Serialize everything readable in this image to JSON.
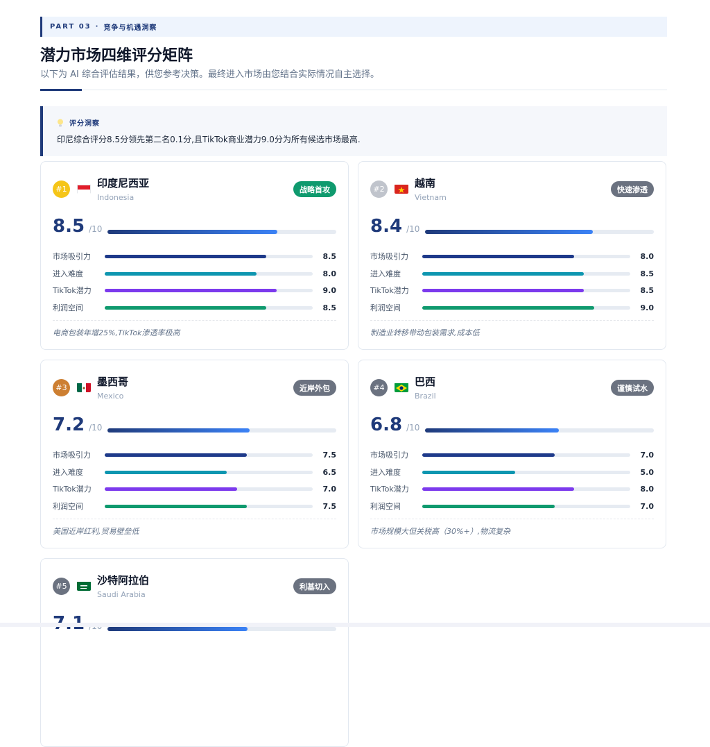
{
  "header": {
    "part_label": "PART 03",
    "part_sep": "·",
    "part_title": "竞争与机遇洞察",
    "title": "潜力市场四维评分矩阵",
    "subtitle": "以下为 AI 综合评估结果，供您参考决策。最终进入市场由您结合实际情况自主选择。"
  },
  "insight": {
    "icon": "lightbulb-icon",
    "label": "评分洞察",
    "text": "印尼综合评分8.5分领先第二名0.1分,且TikTok商业潜力9.0分为所有候选市场最高."
  },
  "score_suffix": "/10",
  "metric_labels": [
    "市场吸引力",
    "进入难度",
    "TikTok潜力",
    "利润空间"
  ],
  "metric_colors": [
    "#1e3a8a",
    "#0e96b0",
    "#7c3aed",
    "#0f9a6e"
  ],
  "markets": [
    {
      "rank": "#1",
      "rank_color": "#f5c518",
      "name": "印度尼西亚",
      "en": "Indonesia",
      "badge": "战略首攻",
      "badge_color": "#0f9a6e",
      "score": "8.5",
      "score_value": 8.5,
      "metrics": [
        "8.5",
        "8.0",
        "9.0",
        "8.5"
      ],
      "note": "电商包装年增25%,TikTok渗透率极高"
    },
    {
      "rank": "#2",
      "rank_color": "#c0c4cc",
      "name": "越南",
      "en": "Vietnam",
      "badge": "快速渗透",
      "badge_color": "#6b7280",
      "score": "8.4",
      "score_value": 8.4,
      "metrics": [
        "8.0",
        "8.5",
        "8.5",
        "9.0"
      ],
      "note": "制造业转移带动包装需求,成本低"
    },
    {
      "rank": "#3",
      "rank_color": "#cd7f32",
      "name": "墨西哥",
      "en": "Mexico",
      "badge": "近岸外包",
      "badge_color": "#6b7280",
      "score": "7.2",
      "score_value": 7.2,
      "metrics": [
        "7.5",
        "6.5",
        "7.0",
        "7.5"
      ],
      "note": "美国近岸红利,贸易壁垒低"
    },
    {
      "rank": "#4",
      "rank_color": "#6b7280",
      "name": "巴西",
      "en": "Brazil",
      "badge": "谨慎试水",
      "badge_color": "#6b7280",
      "score": "6.8",
      "score_value": 6.8,
      "metrics": [
        "7.0",
        "5.0",
        "8.0",
        "7.0"
      ],
      "note": "市场规模大但关税高（30%+）,物流复杂"
    },
    {
      "rank": "#5",
      "rank_color": "#6b7280",
      "name": "沙特阿拉伯",
      "en": "Saudi Arabia",
      "badge": "利基切入",
      "badge_color": "#6b7280",
      "score": "7.1",
      "score_value": 7.1,
      "metrics": [],
      "note": ""
    }
  ]
}
